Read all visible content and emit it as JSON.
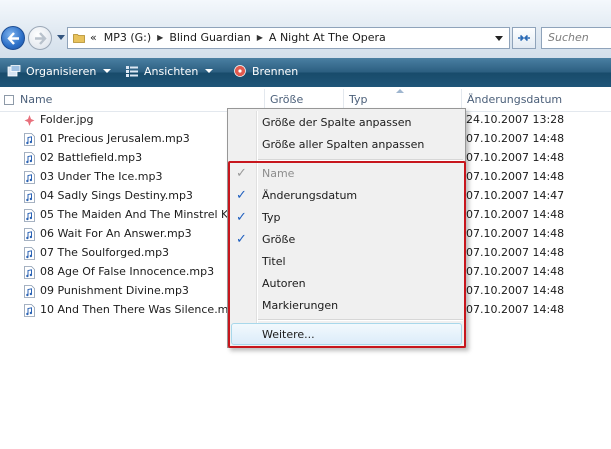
{
  "address": {
    "prefix": "«",
    "crumbs": [
      "MP3 (G:)",
      "Blind Guardian",
      "A Night At The Opera"
    ],
    "search_placeholder": "Suchen"
  },
  "toolbar": {
    "organize": "Organisieren",
    "views": "Ansichten",
    "burn": "Brennen"
  },
  "columns": {
    "name": "Name",
    "size": "Größe",
    "type": "Typ",
    "date": "Änderungsdatum"
  },
  "files": [
    {
      "name": "Folder.jpg",
      "date": "24.10.2007 13:28",
      "icon": "image-file-icon"
    },
    {
      "name": "01 Precious Jerusalem.mp3",
      "date": "07.10.2007 14:48",
      "icon": "audio-file-icon"
    },
    {
      "name": "02 Battlefield.mp3",
      "date": "07.10.2007 14:48",
      "icon": "audio-file-icon"
    },
    {
      "name": "03 Under The Ice.mp3",
      "date": "07.10.2007 14:48",
      "icon": "audio-file-icon"
    },
    {
      "name": "04 Sadly Sings Destiny.mp3",
      "date": "07.10.2007 14:47",
      "icon": "audio-file-icon"
    },
    {
      "name": "05 The Maiden And The Minstrel Kr",
      "date": "07.10.2007 14:48",
      "icon": "audio-file-icon"
    },
    {
      "name": "06 Wait For An Answer.mp3",
      "date": "07.10.2007 14:48",
      "icon": "audio-file-icon"
    },
    {
      "name": "07 The Soulforged.mp3",
      "date": "07.10.2007 14:48",
      "icon": "audio-file-icon"
    },
    {
      "name": "08 Age Of False Innocence.mp3",
      "date": "07.10.2007 14:48",
      "icon": "audio-file-icon"
    },
    {
      "name": "09 Punishment Divine.mp3",
      "date": "07.10.2007 14:48",
      "icon": "audio-file-icon"
    },
    {
      "name": "10 And Then There Was Silence.mp",
      "date": "07.10.2007 14:48",
      "icon": "audio-file-icon"
    }
  ],
  "menu": {
    "fit_column": "Größe der Spalte anpassen",
    "fit_all_columns": "Größe aller Spalten anpassen",
    "items": [
      {
        "label": "Name",
        "checked": true,
        "disabled": true
      },
      {
        "label": "Änderungsdatum",
        "checked": true,
        "disabled": false
      },
      {
        "label": "Typ",
        "checked": true,
        "disabled": false
      },
      {
        "label": "Größe",
        "checked": true,
        "disabled": false
      },
      {
        "label": "Titel",
        "checked": false,
        "disabled": false
      },
      {
        "label": "Autoren",
        "checked": false,
        "disabled": false
      },
      {
        "label": "Markierungen",
        "checked": false,
        "disabled": false
      }
    ],
    "more": "Weitere...",
    "check_glyph": "✓"
  },
  "colors": {
    "toolbar": "#1f5578",
    "highlight_border": "#c7161d",
    "check": "#1f5fbf"
  }
}
